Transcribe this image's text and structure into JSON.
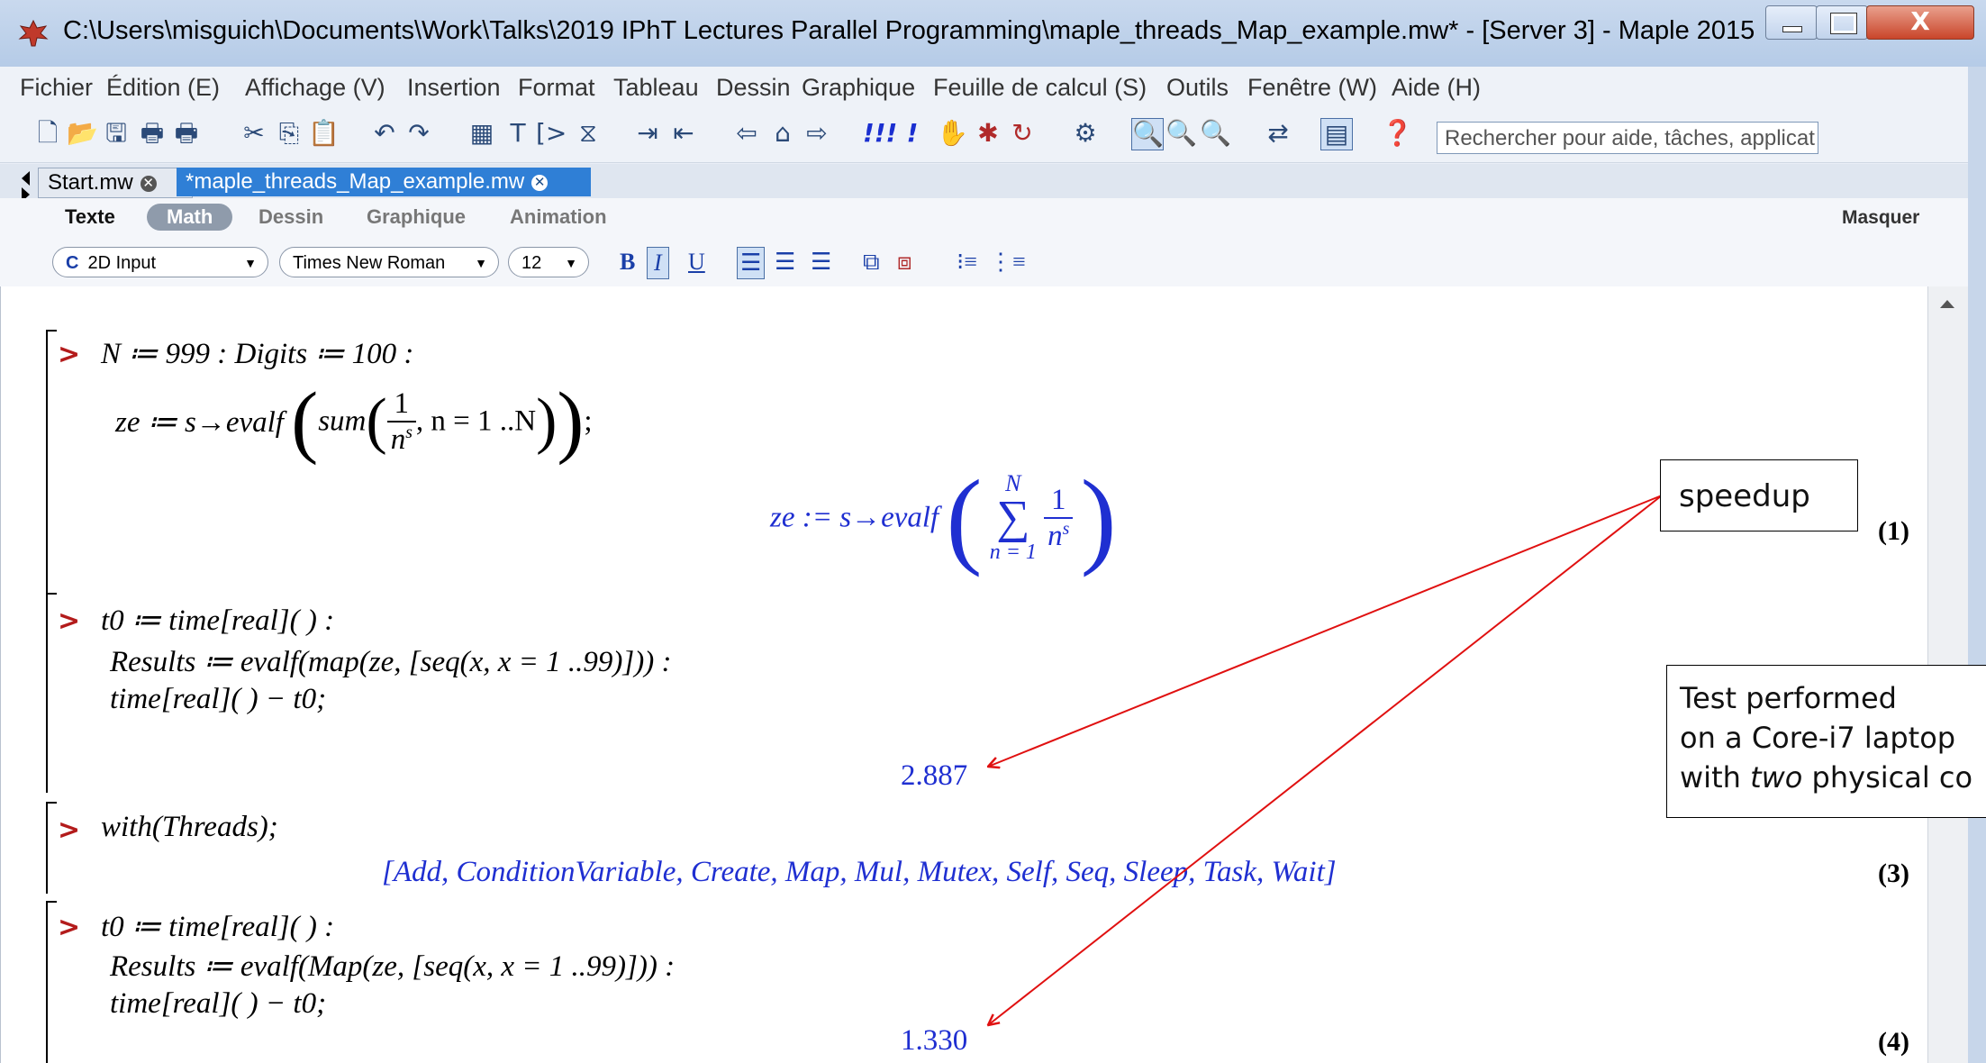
{
  "window": {
    "title": "C:\\Users\\misguich\\Documents\\Work\\Talks\\2019 IPhT Lectures Parallel Programming\\maple_threads_Map_example.mw* - [Server 3] - Maple 2015",
    "close_glyph": "X"
  },
  "menu": [
    "Fichier",
    "Édition (E)",
    "Affichage (V)",
    "Insertion",
    "Format",
    "Tableau",
    "Dessin",
    "Graphique",
    "Feuille de calcul (S)",
    "Outils",
    "Fenêtre (W)",
    "Aide (H)"
  ],
  "toolbar": {
    "icons": [
      "new-icon",
      "open-icon",
      "save-icon",
      "print-icon",
      "print-preview-icon",
      "cut-icon",
      "copy-icon",
      "paste-icon",
      "undo-icon",
      "redo-icon",
      "text-region-icon",
      "text-icon",
      "prompt-icon",
      "section-icon",
      "indent-icon",
      "outdent-icon",
      "back-icon",
      "home-icon",
      "forward-icon",
      "execute-all-icon",
      "execute-icon",
      "stop-icon",
      "debug-icon",
      "restart-icon",
      "settings-icon",
      "zoom-100-icon",
      "zoom-150-icon",
      "zoom-200-icon",
      "toggle-icon",
      "layout-icon",
      "help-icon"
    ],
    "search_placeholder": "Rechercher pour aide, tâches, applicat"
  },
  "tabs": [
    {
      "label": "Start.mw",
      "active": false
    },
    {
      "label": "*maple_threads_Map_example.mw",
      "active": true
    }
  ],
  "modes": {
    "texte": "Texte",
    "math": "Math",
    "dessin": "Dessin",
    "graphique": "Graphique",
    "animation": "Animation",
    "hide": "Masquer"
  },
  "format": {
    "input_mode": "2D Input",
    "font": "Times New Roman",
    "size": "12",
    "bold": "B",
    "italic": "I",
    "underline": "U"
  },
  "worksheet": {
    "prompt": ">",
    "cmd1_line1": "N ≔ 999 : Digits ≔ 100 :",
    "cmd1_lhs": "ze ≔ s→evalf",
    "cmd1_sum": "sum",
    "cmd1_num": "1",
    "cmd1_den": "n",
    "cmd1_exp": "s",
    "cmd1_range": ", n = 1 ..N",
    "out1_lhs": "ze := s→evalf",
    "out1_top": "N",
    "out1_sigma": "∑",
    "out1_bottom": "n = 1",
    "out1_num": "1",
    "out1_den": "n",
    "out1_exp": "s",
    "label1": "(1)",
    "cmd2_line1": "t0 ≔ time[real]( ) :",
    "cmd2_line2": "Results ≔ evalf(map(ze, [seq(x, x = 1 ..99)])) :",
    "cmd2_line3": "time[real]( ) − t0;",
    "out2": "2.887",
    "cmd3": "with(Threads);",
    "out3": "[Add, ConditionVariable, Create, Map, Mul, Mutex, Self, Seq, Sleep, Task, Wait]",
    "label3": "(3)",
    "cmd4_line1": "t0 ≔ time[real]( ) :",
    "cmd4_line2": "Results ≔ evalf(Map(ze, [seq(x, x = 1 ..99)])) :",
    "cmd4_line3": "time[real]( ) − t0;",
    "out4": "1.330",
    "label4": "(4)"
  },
  "annotations": {
    "speedup": "speedup",
    "test_line1": "Test performed",
    "test_line2": "on a Core-i7 laptop",
    "test_line3_pre": "with ",
    "test_line3_em": "two",
    "test_line3_post": " physical co",
    "arrow_color": "#e01010"
  },
  "colors": {
    "output": "#1f2fd1",
    "prompt": "#b31b1b",
    "active_tab": "#2f7fd6"
  }
}
